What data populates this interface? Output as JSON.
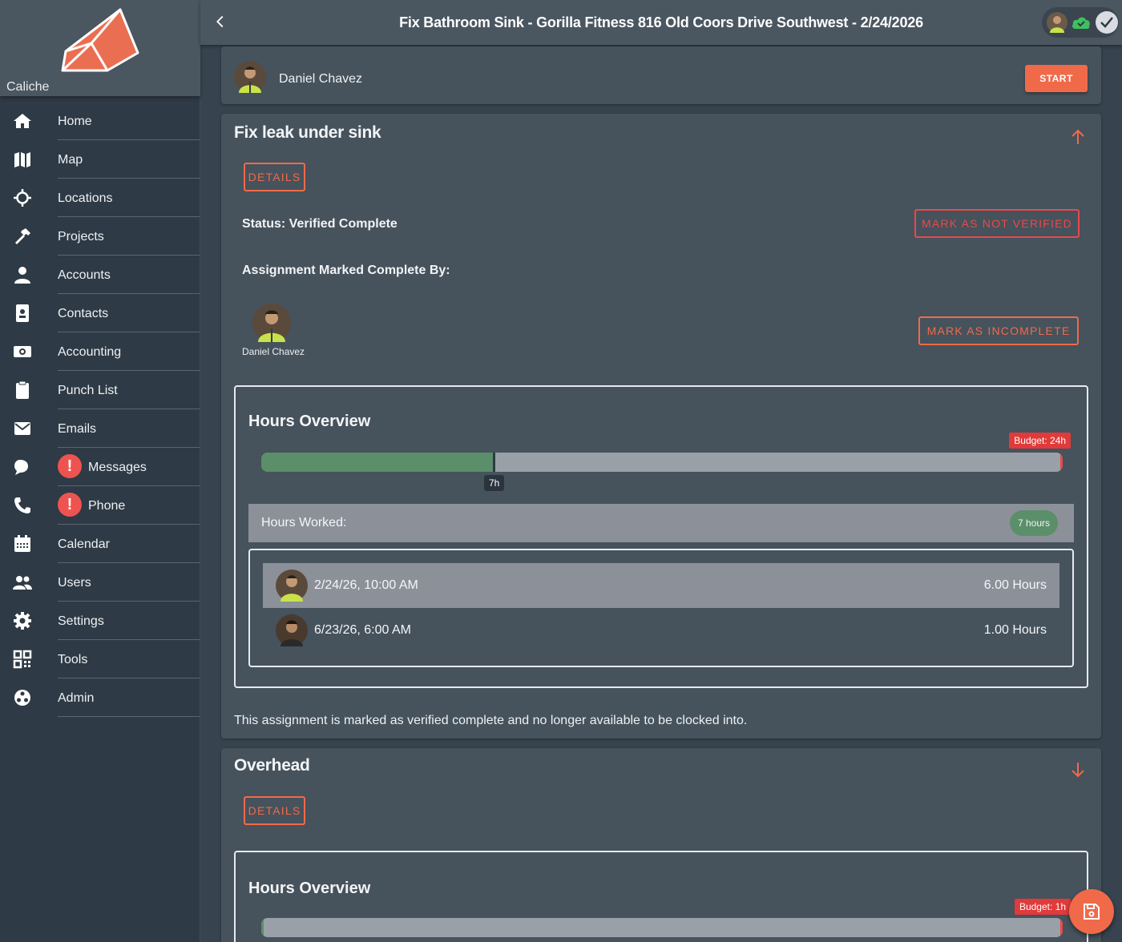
{
  "app": {
    "name": "Caliche"
  },
  "header": {
    "title": "Fix Bathroom Sink - Gorilla Fitness 816 Old Coors Drive Southwest - 2/24/2026"
  },
  "sidebar": {
    "items": [
      {
        "label": "Home",
        "icon": "home-icon"
      },
      {
        "label": "Map",
        "icon": "map-icon"
      },
      {
        "label": "Locations",
        "icon": "crosshair-icon"
      },
      {
        "label": "Projects",
        "icon": "hammer-icon"
      },
      {
        "label": "Accounts",
        "icon": "person-icon"
      },
      {
        "label": "Contacts",
        "icon": "contact-card-icon"
      },
      {
        "label": "Accounting",
        "icon": "money-icon"
      },
      {
        "label": "Punch List",
        "icon": "clipboard-icon"
      },
      {
        "label": "Emails",
        "icon": "envelope-icon"
      },
      {
        "label": "Messages",
        "icon": "chat-icon",
        "badge": "!"
      },
      {
        "label": "Phone",
        "icon": "phone-icon",
        "badge": "!"
      },
      {
        "label": "Calendar",
        "icon": "calendar-icon"
      },
      {
        "label": "Users",
        "icon": "users-icon"
      },
      {
        "label": "Settings",
        "icon": "gear-icon"
      },
      {
        "label": "Tools",
        "icon": "qr-code-icon"
      },
      {
        "label": "Admin",
        "icon": "admin-icon"
      }
    ]
  },
  "worker": {
    "name": "Daniel Chavez",
    "start_label": "START"
  },
  "assignment": {
    "title": "Fix leak under sink",
    "details_label": "DETAILS",
    "status": "Status: Verified Complete",
    "mark_not_verified_label": "MARK AS NOT VERIFIED",
    "completed_by_label": "Assignment Marked Complete By:",
    "completed_by_name": "Daniel Chavez",
    "mark_incomplete_label": "MARK AS INCOMPLETE",
    "hours": {
      "title": "Hours Overview",
      "budget_label": "Budget: 24h",
      "budget_hours": 24,
      "worked_hours": 7,
      "worked_tag": "7h",
      "worked_label": "Hours Worked:",
      "worked_chip": "7 hours",
      "entries": [
        {
          "date": "2/24/26, 10:00 AM",
          "hours": "6.00 Hours"
        },
        {
          "date": "6/23/26, 6:00 AM",
          "hours": "1.00 Hours"
        }
      ]
    },
    "note": "This assignment is marked as verified complete and no longer available to be clocked into."
  },
  "overhead": {
    "title": "Overhead",
    "details_label": "DETAILS",
    "hours": {
      "title": "Hours Overview",
      "budget_label": "Budget: 1h",
      "budget_hours": 1,
      "worked_hours": 0
    }
  },
  "colors": {
    "accent": "#f06a4a",
    "success": "#5a8f6a",
    "danger": "#e03a3a",
    "online": "#3fbf5f"
  }
}
